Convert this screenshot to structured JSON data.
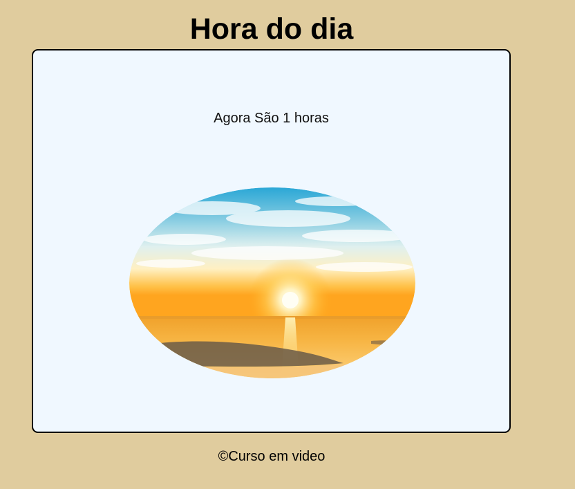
{
  "header": {
    "title": "Hora do dia"
  },
  "main": {
    "time_message": "Agora São 1 horas",
    "image": {
      "subject": "sunrise-over-sea",
      "colors": {
        "sky_top": "#2aa7d6",
        "sky_mid": "#d8eef2",
        "horizon": "#ffb128",
        "sun": "#fffbe8",
        "sea": "#f8b13e",
        "sand": "#6a5a48"
      }
    }
  },
  "footer": {
    "text": "©Curso em video"
  },
  "colors": {
    "page_background": "#e0cc9e",
    "card_background": "#f0f8ff",
    "card_border": "#000000"
  }
}
